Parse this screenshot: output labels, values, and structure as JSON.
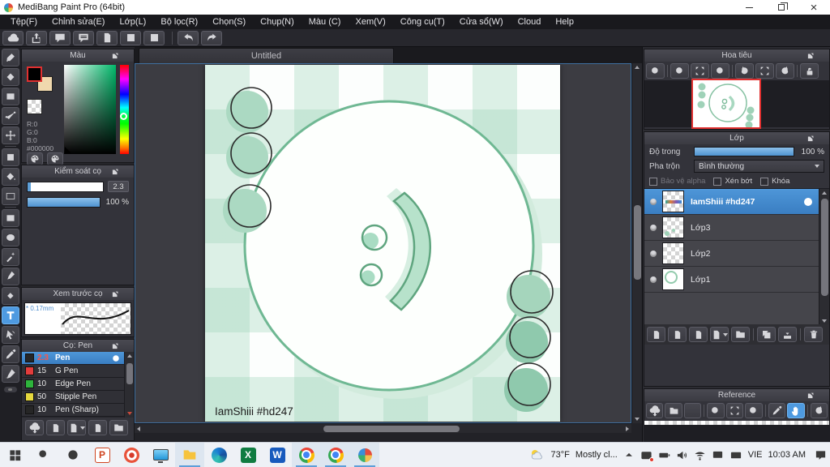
{
  "window": {
    "title": "MediBang Paint Pro (64bit)"
  },
  "icons": {
    "close": "×"
  },
  "menu": {
    "items": [
      "Tệp(F)",
      "Chỉnh sửa(E)",
      "Lớp(L)",
      "Bộ lọc(R)",
      "Chọn(S)",
      "Chụp(N)",
      "Màu (C)",
      "Xem(V)",
      "Công cụ(T)",
      "Cửa sổ(W)",
      "Cloud",
      "Help"
    ]
  },
  "color_panel": {
    "title": "Màu",
    "r": "R:0",
    "g": "G:0",
    "b": "B:0",
    "hex": "#000000",
    "foreground": "#000000",
    "background_swatch": "#f0d8ae"
  },
  "brush_control": {
    "title": "Kiểm soát cọ",
    "size": "2.3",
    "opacity": "100 %"
  },
  "brush_preview": {
    "title": "Xem trước cọ",
    "size_label": "* 0.17mm"
  },
  "brush_panel": {
    "title": "Cọ: Pen",
    "brushes": [
      {
        "size": "2.3",
        "name": "Pen",
        "swatch": "#262626",
        "selected": true
      },
      {
        "size": "15",
        "name": "G Pen",
        "swatch": "#e23c3c",
        "selected": false
      },
      {
        "size": "10",
        "name": "Edge Pen",
        "swatch": "#2eb43c",
        "selected": false
      },
      {
        "size": "50",
        "name": "Stipple Pen",
        "swatch": "#e6d83e",
        "selected": false
      },
      {
        "size": "10",
        "name": "Pen (Sharp)",
        "swatch": "#262626",
        "selected": false
      }
    ]
  },
  "canvas": {
    "tab": "Untitled",
    "signature": "IamShiii #hd247",
    "outline_color": "#6fb893",
    "fill_color": "#abd9c2"
  },
  "navigator": {
    "title": "Hoa tiêu"
  },
  "layers": {
    "title": "Lớp",
    "opacity_label": "Độ trong",
    "opacity_value": "100 %",
    "blend_label": "Pha trộn",
    "blend_value": "Bình thường",
    "alpha_lock_label": "Bảo vệ alpha",
    "clipping_label": "Xén bớt",
    "lock_label": "Khóa",
    "items": [
      {
        "name": "IamShiii #hd247",
        "selected": true
      },
      {
        "name": "Lớp3",
        "selected": false
      },
      {
        "name": "Lớp2",
        "selected": false
      },
      {
        "name": "Lớp1",
        "selected": false
      }
    ]
  },
  "reference": {
    "title": "Reference"
  },
  "taskbar": {
    "weather_temp": "73°F",
    "weather_cond": "Mostly cl...",
    "language": "VIE",
    "time": "10:03 AM",
    "app_letters": {
      "powerpoint": "P",
      "excel": "X",
      "word": "W"
    }
  }
}
